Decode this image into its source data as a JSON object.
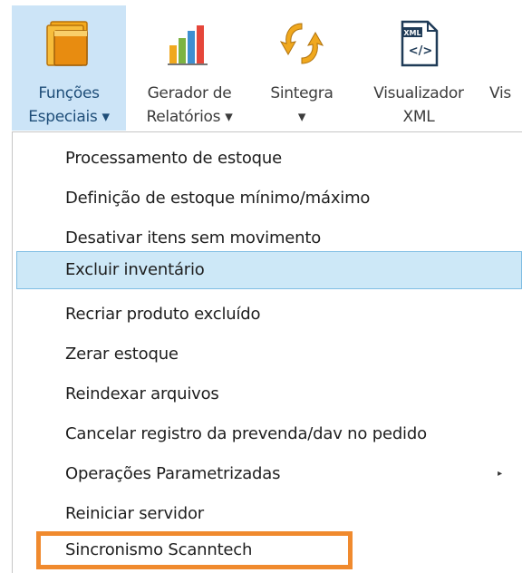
{
  "ribbon": {
    "buttons": [
      {
        "line1": "Funções",
        "line2": "Especiais ▾",
        "icon": "folders-icon"
      },
      {
        "line1": "Gerador de",
        "line2": "Relatórios ▾",
        "icon": "bar-chart-icon"
      },
      {
        "line1": "Sintegra",
        "line2": "▾",
        "icon": "sync-arrows-icon"
      },
      {
        "line1": "Visualizador",
        "line2": "XML",
        "icon": "xml-file-icon"
      },
      {
        "line1": "Vis",
        "line2": "",
        "icon": "truncated-icon"
      }
    ],
    "xml_badge": "XML",
    "xml_tag": "</>"
  },
  "menu": {
    "items": [
      {
        "label": "Processamento de estoque"
      },
      {
        "label": "Definição de estoque mínimo/máximo"
      },
      {
        "label": "Desativar itens sem movimento"
      },
      {
        "label": "Excluir inventário"
      },
      {
        "label": "Recriar produto excluído"
      },
      {
        "label": "Zerar estoque"
      },
      {
        "label": "Reindexar arquivos"
      },
      {
        "label": "Cancelar registro da prevenda/dav no pedido"
      },
      {
        "label": "Operações Parametrizadas"
      },
      {
        "label": "Reiniciar servidor"
      },
      {
        "label": "Sincronismo Scanntech"
      }
    ],
    "submenu_arrow": "▸"
  },
  "colors": {
    "active_ribbon_bg": "#cce4f7",
    "hover_item_bg": "#cde8f7",
    "highlight_border": "#f08a2e"
  }
}
